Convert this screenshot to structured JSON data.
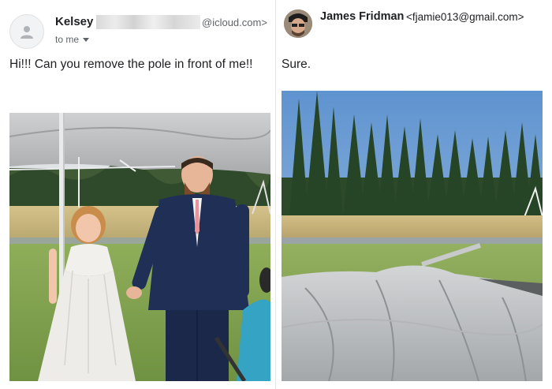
{
  "left_email": {
    "sender_name": "Kelsey",
    "sender_email_suffix": "@icloud.com>",
    "recipient_label": "to me",
    "avatar_icon": "person-icon",
    "message": "Hi!!! Can you remove the pole in front of me!!"
  },
  "right_email": {
    "sender_name": "James Fridman",
    "sender_email": "<fjamie013@gmail.com>",
    "message": "Sure."
  },
  "colors": {
    "primary_text": "#202124",
    "secondary_text": "#5f6368",
    "sky": "#7aa7d8",
    "grass": "#7ea04e"
  }
}
